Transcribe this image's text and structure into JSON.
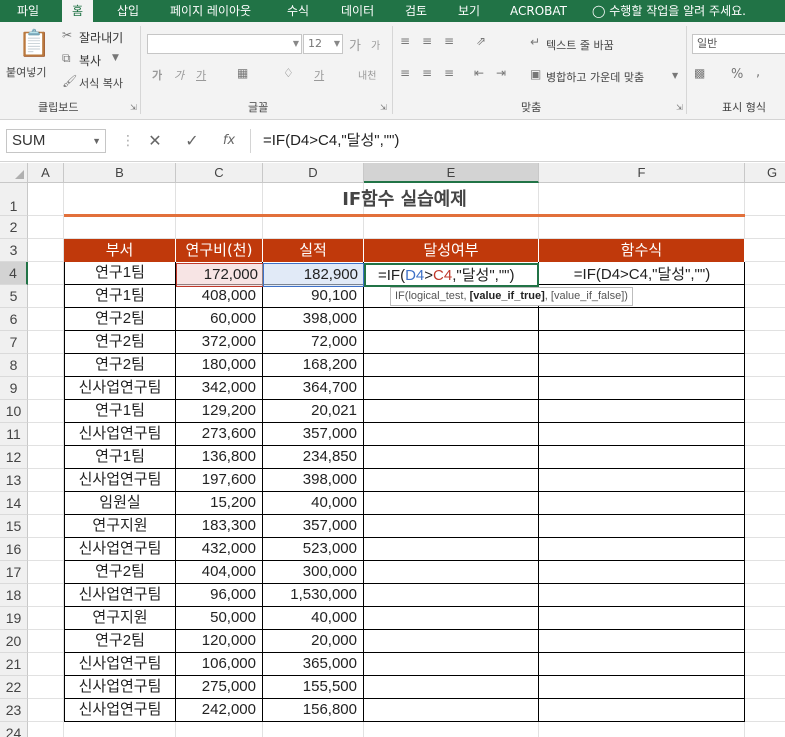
{
  "ribbon_tabs": [
    "파일",
    "홈",
    "삽입",
    "페이지 레이아웃",
    "수식",
    "데이터",
    "검토",
    "보기",
    "ACROBAT"
  ],
  "active_tab": "홈",
  "tell_me": "수행할 작업을 알려 주세요.",
  "clipboard": {
    "paste": "붙여넣기",
    "cut": "잘라내기",
    "copy": "복사",
    "format_painter": "서식 복사",
    "group": "클립보드"
  },
  "font": {
    "name_value": "",
    "size_value": "12",
    "grow": "가",
    "shrink": "가",
    "bold": "가",
    "italic": "가",
    "underline": "가",
    "text_color": "가",
    "phonetic": "내천",
    "group": "글꼴"
  },
  "alignment": {
    "wrap_text": "텍스트 줄 바꿈",
    "merge_center": "병합하고 가운데 맞춤",
    "group": "맞춤"
  },
  "number": {
    "format_value": "일반",
    "percent": "%",
    "comma": ",",
    "group": "표시 형식"
  },
  "formula_bar": {
    "name_box": "SUM",
    "cancel": "✕",
    "enter": "✓",
    "insert_function": "fx",
    "formula": "=IF(D4>C4,\"달성\",\"\")"
  },
  "columns": [
    "A",
    "B",
    "C",
    "D",
    "E",
    "F",
    "G"
  ],
  "rows": [
    "1",
    "2",
    "3",
    "4",
    "5",
    "6",
    "7",
    "8",
    "9",
    "10",
    "11",
    "12",
    "13",
    "14",
    "15",
    "16",
    "17",
    "18",
    "19",
    "20",
    "21",
    "22",
    "23",
    "24"
  ],
  "sheet_title": "IF함수 실습예제",
  "table_headers": [
    "부서",
    "연구비(천)",
    "실적",
    "달성여부",
    "함수식"
  ],
  "table_rows": [
    [
      "연구1팀",
      "172,000",
      "182,900"
    ],
    [
      "연구1팀",
      "408,000",
      "90,100"
    ],
    [
      "연구2팀",
      "60,000",
      "398,000"
    ],
    [
      "연구2팀",
      "372,000",
      "72,000"
    ],
    [
      "연구2팀",
      "180,000",
      "168,200"
    ],
    [
      "신사업연구팀",
      "342,000",
      "364,700"
    ],
    [
      "연구1팀",
      "129,200",
      "20,021"
    ],
    [
      "신사업연구팀",
      "273,600",
      "357,000"
    ],
    [
      "연구1팀",
      "136,800",
      "234,850"
    ],
    [
      "신사업연구팀",
      "197,600",
      "398,000"
    ],
    [
      "임원실",
      "15,200",
      "40,000"
    ],
    [
      "연구지원",
      "183,300",
      "357,000"
    ],
    [
      "신사업연구팀",
      "432,000",
      "523,000"
    ],
    [
      "연구2팀",
      "404,000",
      "300,000"
    ],
    [
      "신사업연구팀",
      "96,000",
      "1,530,000"
    ],
    [
      "연구지원",
      "50,000",
      "40,000"
    ],
    [
      "연구2팀",
      "120,000",
      "20,000"
    ],
    [
      "신사업연구팀",
      "106,000",
      "365,000"
    ],
    [
      "신사업연구팀",
      "275,000",
      "155,500"
    ],
    [
      "신사업연구팀",
      "242,000",
      "156,800"
    ]
  ],
  "editing_cell": {
    "prefix": "=IF(",
    "ref1": "D4",
    "op": ">",
    "ref2": "C4",
    "suffix": ",\"달성\",\"\")"
  },
  "formula_text_f4": "=IF(D4>C4,\"달성\",\"\")",
  "tooltip": {
    "start": "IF(logical_test, ",
    "bold": "[value_if_true]",
    "end": ", [value_if_false])"
  },
  "colors": {
    "excel_green": "#217346",
    "header_fill": "#c0390b",
    "title_underline": "#e2703b",
    "ref_d4": "#3e71c7",
    "ref_c4": "#c0392b"
  }
}
